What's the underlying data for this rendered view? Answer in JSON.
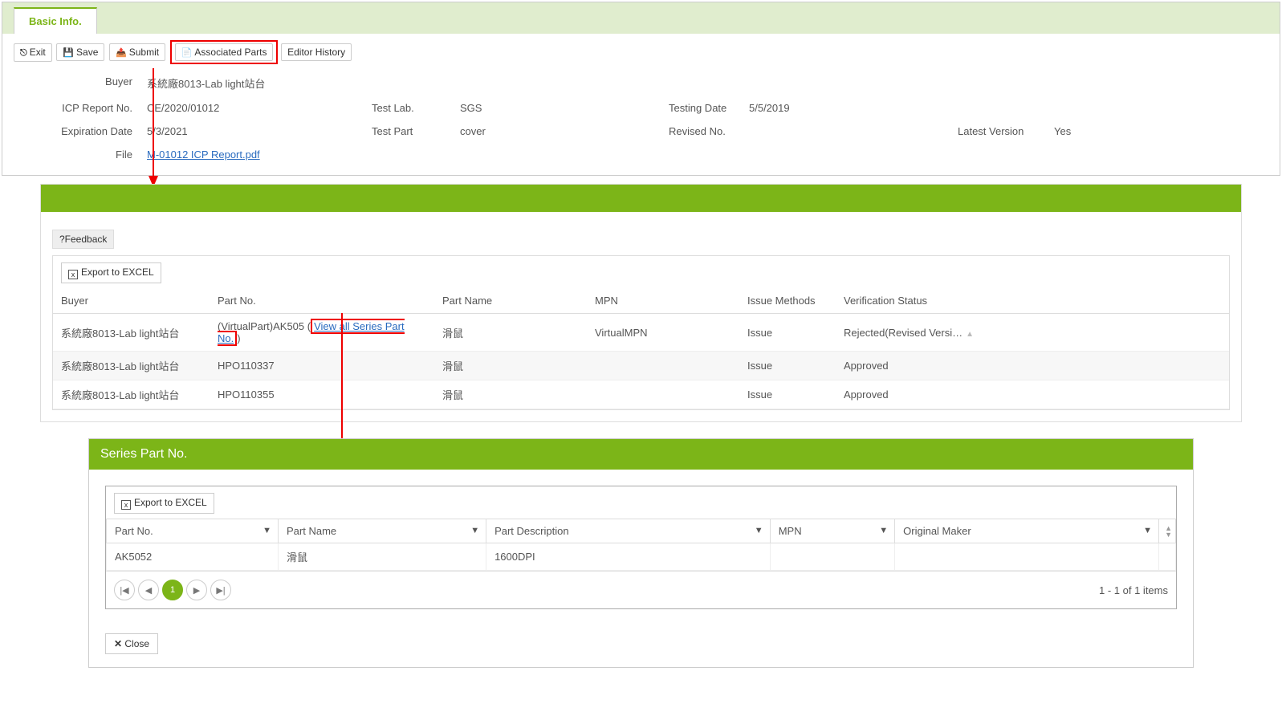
{
  "tab": "Basic Info.",
  "toolbar": {
    "exit": "Exit",
    "save": "Save",
    "submit": "Submit",
    "assoc": "Associated Parts",
    "history": "Editor History"
  },
  "info": {
    "buyer_label": "Buyer",
    "buyer": "系統廠8013-Lab light站台",
    "icp_label": "ICP Report No.",
    "icp": "CE/2020/01012",
    "testlab_label": "Test Lab.",
    "testlab": "SGS",
    "testdate_label": "Testing Date",
    "testdate": "5/5/2019",
    "exp_label": "Expiration Date",
    "exp": "5/3/2021",
    "testpart_label": "Test Part",
    "testpart": "cover",
    "rev_label": "Revised No.",
    "rev": "",
    "latest_label": "Latest Version",
    "latest": "Yes",
    "file_label": "File",
    "file": "M-01012 ICP Report.pdf"
  },
  "feedback": "?Feedback",
  "export": "Export to EXCEL",
  "t1": {
    "h": [
      "Buyer",
      "Part No.",
      "Part Name",
      "MPN",
      "Issue Methods",
      "Verification Status"
    ],
    "rows": [
      {
        "buyer": "系統廠8013-Lab light站台",
        "partno": "(VirtualPart)AK505 (",
        "series": "View all Series Part No.",
        "close": ")",
        "pname": "滑鼠",
        "mpn": "VirtualMPN",
        "issue": "Issue",
        "vs": "Rejected(Revised Versi…"
      },
      {
        "buyer": "系統廠8013-Lab light站台",
        "partno": "HPO110337",
        "pname": "滑鼠",
        "mpn": "",
        "issue": "Issue",
        "vs": "Approved"
      },
      {
        "buyer": "系統廠8013-Lab light站台",
        "partno": "HPO110355",
        "pname": "滑鼠",
        "mpn": "",
        "issue": "Issue",
        "vs": "Approved"
      }
    ]
  },
  "series_title": "Series Part No.",
  "t2": {
    "h": [
      "Part No.",
      "Part Name",
      "Part Description",
      "MPN",
      "Original Maker"
    ],
    "rows": [
      {
        "pn": "AK5052",
        "pname": "滑鼠",
        "desc": "1600DPI",
        "mpn": "",
        "maker": ""
      }
    ]
  },
  "pager": {
    "page": "1",
    "info": "1 - 1 of 1 items"
  },
  "close": "Close"
}
